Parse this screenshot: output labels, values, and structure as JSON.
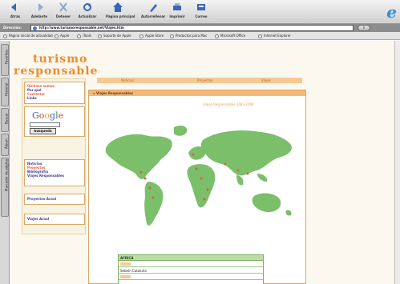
{
  "toolbar": {
    "buttons": [
      {
        "label": "Atrás"
      },
      {
        "label": "Adelante"
      },
      {
        "label": "Detener"
      },
      {
        "label": "Actualizar"
      },
      {
        "label": "Página principal"
      },
      {
        "label": "Autorrellenar"
      },
      {
        "label": "Imprimir"
      },
      {
        "label": "Correo"
      }
    ]
  },
  "address": {
    "label": "Dirección:",
    "url": "http://www.turismoresponsable.net/Viajes.htm",
    "go_label": "Ir"
  },
  "favorites": [
    "Página inicial de actualidad",
    "Apple",
    "iTools",
    "Soporte de Apple",
    "Apple Store",
    "Productos para Mac",
    "Microsoft Office",
    "Internet Explorer"
  ],
  "explorer_tabs": [
    "Favoritos",
    "Historial",
    "Buscar",
    "Álbum",
    "Marcador de página"
  ],
  "site": {
    "logo_line1": "turismo",
    "logo_line2": "responsable",
    "nav_items": [
      "Noticias",
      "Proyectos",
      "Viajes"
    ],
    "sidebar_box1": [
      "Quiénes somos",
      "Por qué",
      "Contactar",
      "Links"
    ],
    "google_button": "búsqueda",
    "sidebar_box2": [
      "Noticias",
      "Proyectos",
      "Bibliografía",
      "Viajes Responsables"
    ],
    "sidebar_box3": "Proyectos Acoal",
    "sidebar_box4": "Viajes Acoal",
    "main_header": "» Viajes Responsables",
    "main_subtitle": "Viajes Responsables 2003-2004",
    "table": {
      "region": "AFRICA",
      "rows": [
        "",
        "Sebeln Cataluña",
        ""
      ]
    }
  },
  "colors": {
    "accent": "#f08a2a",
    "map_land": "#7bbf6a",
    "map_marker": "#d9623b"
  }
}
